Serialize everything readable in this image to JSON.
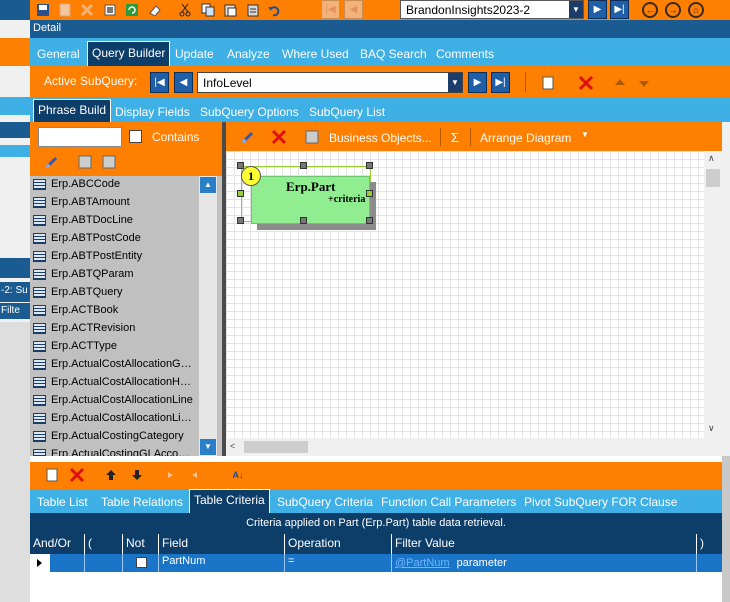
{
  "toolbar": {
    "company_combo": "BrandonInsights2023-2"
  },
  "detail_bar": {
    "title": "Detail"
  },
  "main_tabs": [
    "General",
    "Query Builder",
    "Update",
    "Analyze",
    "Where Used",
    "BAQ Search",
    "Comments"
  ],
  "subquery_bar": {
    "label": "Active SubQuery:",
    "value": "InfoLevel"
  },
  "phrase_tabs": [
    "Phrase Build",
    "Display Fields",
    "SubQuery Options",
    "SubQuery List"
  ],
  "left_panel": {
    "search_value": "",
    "contains_label": "Contains",
    "tables": [
      "Erp.ABCCode",
      "Erp.ABTAmount",
      "Erp.ABTDocLine",
      "Erp.ABTPostCode",
      "Erp.ABTPostEntity",
      "Erp.ABTQParam",
      "Erp.ABTQuery",
      "Erp.ACTBook",
      "Erp.ACTRevision",
      "Erp.ACTType",
      "Erp.ActualCostAllocationG…",
      "Erp.ActualCostAllocationH…",
      "Erp.ActualCostAllocationLine",
      "Erp.ActualCostAllocationLi…",
      "Erp.ActualCostingCategory",
      "Erp.ActualCostingGLAcco…"
    ]
  },
  "diagram_toolbar": {
    "business_objects": "Business Objects...",
    "sigma": "Σ",
    "arrange": "Arrange Diagram"
  },
  "diagram_node": {
    "number": "1",
    "title": "Erp.Part",
    "subtitle": "+criteria"
  },
  "left_strip": {
    "text_a": "-2: Su",
    "text_b": "Filte"
  },
  "bottom_tabs": [
    "Table List",
    "Table Relations",
    "Table Criteria",
    "SubQuery Criteria",
    "Function Call Parameters",
    "Pivot SubQuery FOR Clause"
  ],
  "criteria": {
    "banner": "Criteria applied on Part (Erp.Part)  table data retrieval.",
    "columns": [
      "And/Or",
      "(",
      "Not",
      "Field",
      "Operation",
      "Filter Value",
      ")"
    ],
    "row": {
      "field": "PartNum",
      "operation": "=",
      "filter_link": "@PartNum",
      "filter_suffix": "parameter"
    }
  },
  "colors": {
    "accent_orange": "#ff7f00",
    "tab_blue": "#3fb0e5",
    "navy": "#0d3d69",
    "selected_row": "#1a75c8",
    "node_green": "#90ee90"
  }
}
